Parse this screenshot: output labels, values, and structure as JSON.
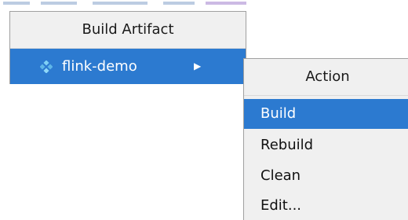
{
  "colors": {
    "selection": "#2c7ad0",
    "menu_background": "#f0f0f0",
    "menu_border": "#a0a0a0"
  },
  "primary_menu": {
    "title": "Build Artifact",
    "items": [
      {
        "label": "flink-demo",
        "icon": "artifact-package-icon",
        "has_submenu": true,
        "selected": true
      }
    ]
  },
  "submenu": {
    "title": "Action",
    "items": [
      {
        "label": "Build",
        "selected": true
      },
      {
        "label": "Rebuild",
        "selected": false
      },
      {
        "label": "Clean",
        "selected": false
      },
      {
        "label": "Edit...",
        "selected": false
      }
    ]
  }
}
